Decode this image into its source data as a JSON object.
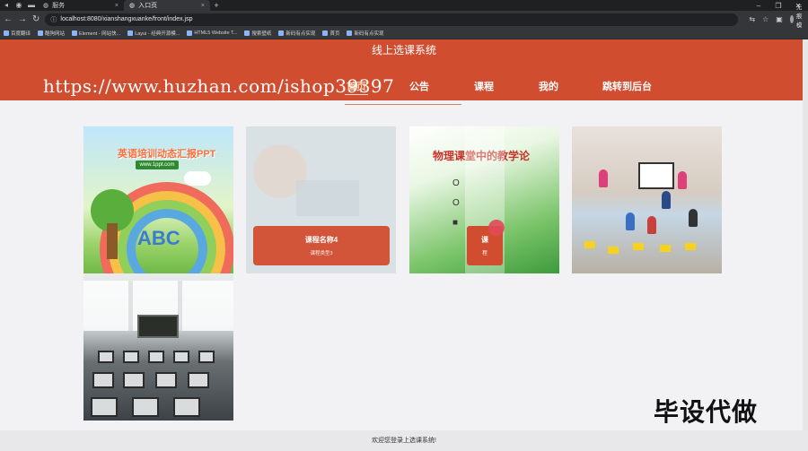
{
  "browser": {
    "tabs": [
      {
        "label": "服务",
        "active": false
      },
      {
        "label": "入口页",
        "active": true
      }
    ],
    "url": "localhost:8080/xianshangxuanke/front/index.jsp",
    "profile": "无痕模式",
    "bookmarks": [
      "百度翻译",
      "酷狗网站",
      "Element - 网站快...",
      "Layui - 经典开源模...",
      "HTML5 Website T...",
      "搜索壁纸",
      "新码有点实现",
      "首页",
      "新码有点实现"
    ]
  },
  "site": {
    "title": "线上选课系统",
    "nav": [
      "首页",
      "公告",
      "课程",
      "我的",
      "跳转到后台"
    ],
    "active_nav": "首页"
  },
  "watermark": {
    "url": "https://www.huzhan.com/ishop39397",
    "corner": "毕设代做"
  },
  "cards": [
    {
      "title": "英语培训动态汇报PPT",
      "badge": "www.1ppt.com",
      "letters": "ABC"
    },
    {
      "title": "课程名称4",
      "type": "课程类型3"
    },
    {
      "title": "物理课堂中的教学论",
      "lines": [
        "O",
        "O",
        "■"
      ],
      "btn_title": "课",
      "btn_type": "程"
    },
    {},
    {}
  ],
  "footer": "欢迎您登录上选课系统!",
  "colors": {
    "brand": "#d14d30"
  }
}
